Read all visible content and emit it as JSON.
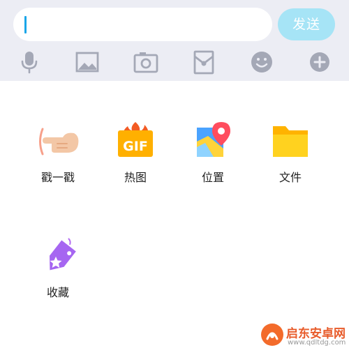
{
  "input_bar": {
    "text_value": "",
    "send_label": "发送"
  },
  "toolbar": {
    "icons": [
      "microphone-icon",
      "image-icon",
      "camera-icon",
      "red-packet-icon",
      "emoji-icon",
      "plus-icon"
    ],
    "icon_color": "#a4a8b6"
  },
  "panel": {
    "items": [
      {
        "label": "戳一戳",
        "icon": "poke-hand-icon"
      },
      {
        "label": "热图",
        "icon": "gif-icon"
      },
      {
        "label": "位置",
        "icon": "location-map-icon"
      },
      {
        "label": "文件",
        "icon": "folder-icon"
      },
      {
        "label": "收藏",
        "icon": "favorites-tag-icon"
      }
    ]
  },
  "watermark": {
    "title": "启东安卓网",
    "url": "www.qdltdg.com"
  },
  "colors": {
    "input_area_bg": "#ecedf4",
    "send_button_bg": "#a6e4f6",
    "cursor": "#1aa6e8"
  }
}
